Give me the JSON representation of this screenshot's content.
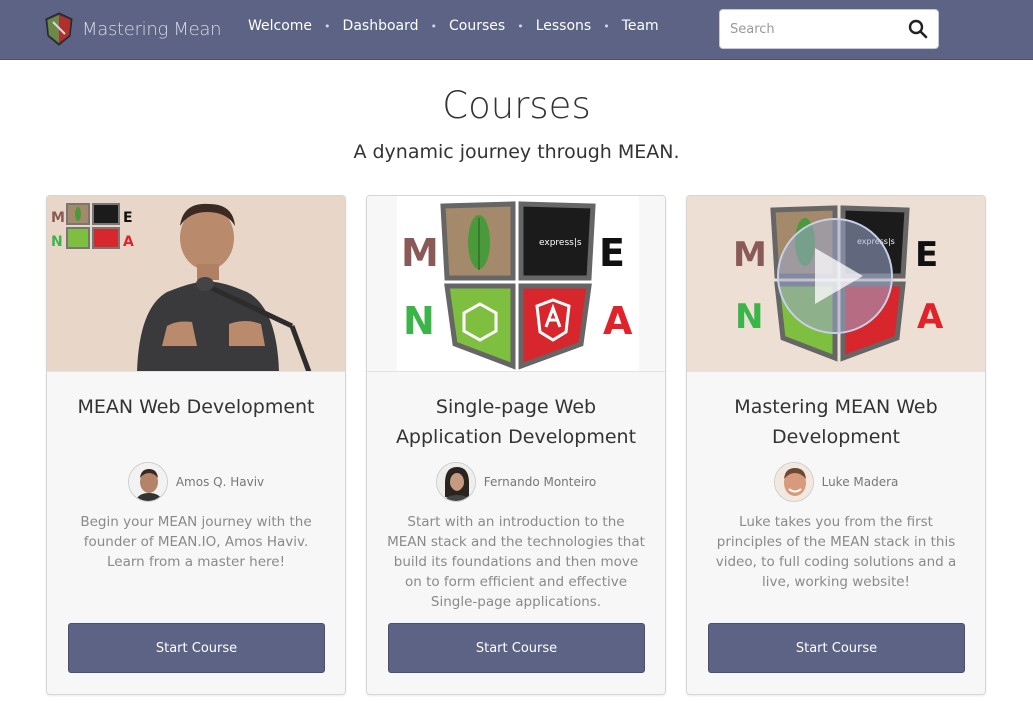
{
  "brand": {
    "name": "Mastering Mean"
  },
  "nav": {
    "items": [
      {
        "label": "Welcome"
      },
      {
        "label": "Dashboard"
      },
      {
        "label": "Courses"
      },
      {
        "label": "Lessons"
      },
      {
        "label": "Team"
      }
    ],
    "separator": "•"
  },
  "search": {
    "placeholder": "Search",
    "value": ""
  },
  "page": {
    "title": "Courses",
    "subtitle": "A dynamic journey through MEAN."
  },
  "stack_letters": {
    "m": "M",
    "e": "E",
    "n": "N",
    "a": "A",
    "express": "express|s"
  },
  "courses": [
    {
      "title": "MEAN Web Development",
      "instructor": "Amos Q. Haviv",
      "description": "Begin your MEAN journey with the founder of MEAN.IO, Amos Haviv. Learn from a master here!",
      "button": "Start Course"
    },
    {
      "title": "Single-page Web Application Development",
      "instructor": "Fernando Monteiro",
      "description": "Start with an introduction to the MEAN stack and the technologies that build its foundations and then move on to form efficient and effective Single-page applications.",
      "button": "Start Course"
    },
    {
      "title": "Mastering MEAN Web Development",
      "instructor": "Luke Madera",
      "description": "Luke takes you from the first principles of the MEAN stack in this video, to full coding solutions and a live, working website!",
      "button": "Start Course"
    }
  ],
  "colors": {
    "navbar": "#5d6385",
    "button": "#5d6385",
    "mongo_green": "#4a9a3c",
    "express_black": "#1b1b1b",
    "node_green": "#7fbf3f",
    "angular_red": "#d7262c",
    "m_letter": "#8a5a58",
    "n_letter": "#3bb54a",
    "a_letter": "#e0232b"
  }
}
